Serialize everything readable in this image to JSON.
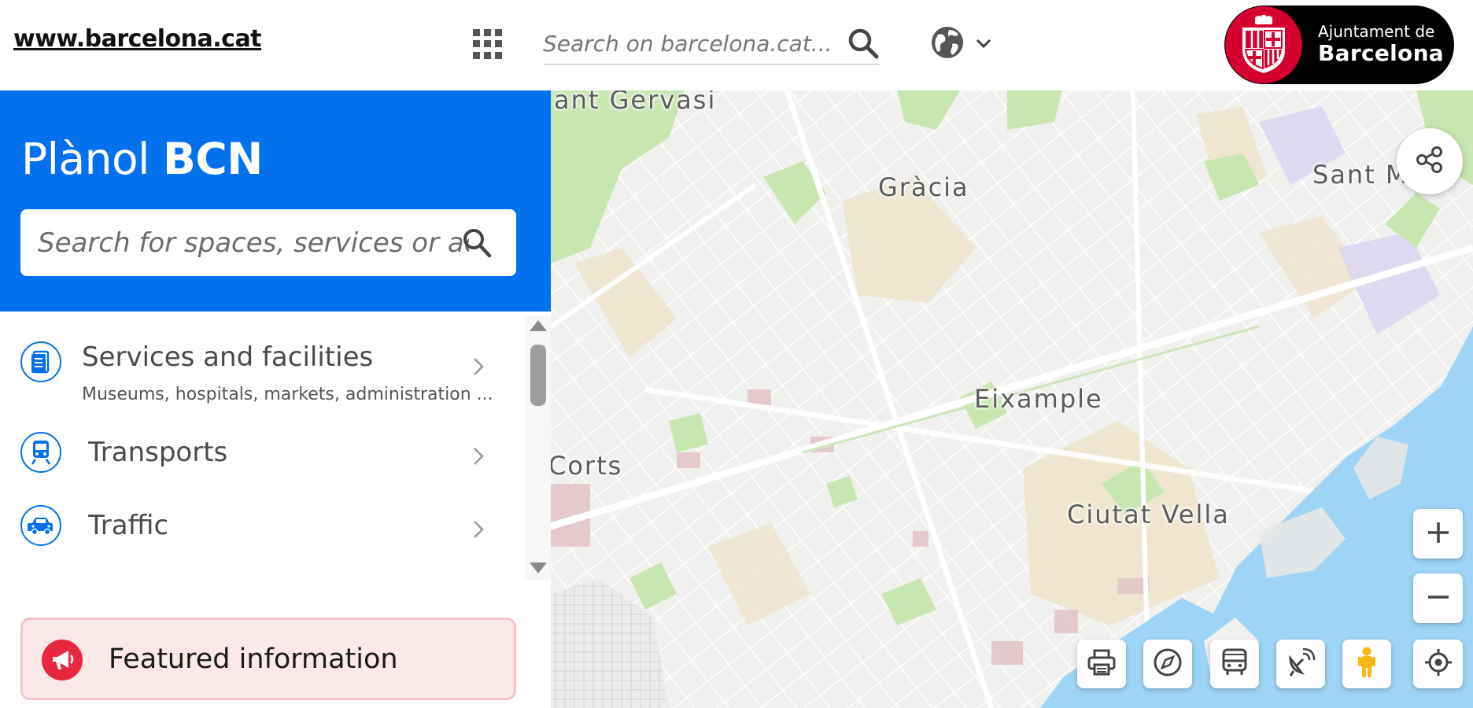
{
  "header": {
    "site_link": "www.barcelona.cat",
    "search_placeholder": "Search on barcelona.cat...",
    "logo_line1": "Ajuntament de",
    "logo_line2": "Barcelona"
  },
  "sidebar": {
    "title_light": "Plànol",
    "title_bold": "BCN",
    "search_placeholder": "Search for spaces, services or address",
    "items": [
      {
        "label": "Services and facilities",
        "subtitle": "Museums, hospitals, markets, administration ...",
        "icon": "document-icon"
      },
      {
        "label": "Transports",
        "icon": "train-icon"
      },
      {
        "label": "Traffic",
        "icon": "car-icon"
      }
    ],
    "featured_label": "Featured information"
  },
  "map": {
    "labels": [
      "ant Gervasi",
      "Gràcia",
      "Sant M",
      "Eixample",
      "Corts",
      "Ciutat Vella"
    ]
  },
  "colors": {
    "primary_blue": "#0371ed",
    "brand_red": "#d4002d",
    "featured_red": "#e8263f",
    "sea": "#9ed4f5",
    "park": "#c8e6b0",
    "district": "#efe4cc"
  }
}
